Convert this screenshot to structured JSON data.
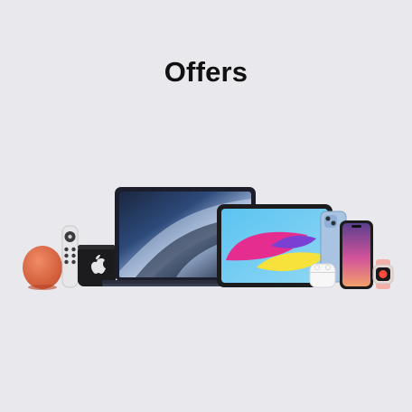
{
  "page": {
    "title": "Offers",
    "background_color": "#e8e8ed"
  },
  "hero_image": {
    "description_icons": [
      "homepod-mini-icon",
      "siri-remote-icon",
      "apple-tv-icon",
      "macbook-air-icon",
      "ipad-icon",
      "airpods-icon",
      "iphone-blue-icon",
      "iphone-purple-icon",
      "apple-watch-icon"
    ]
  }
}
